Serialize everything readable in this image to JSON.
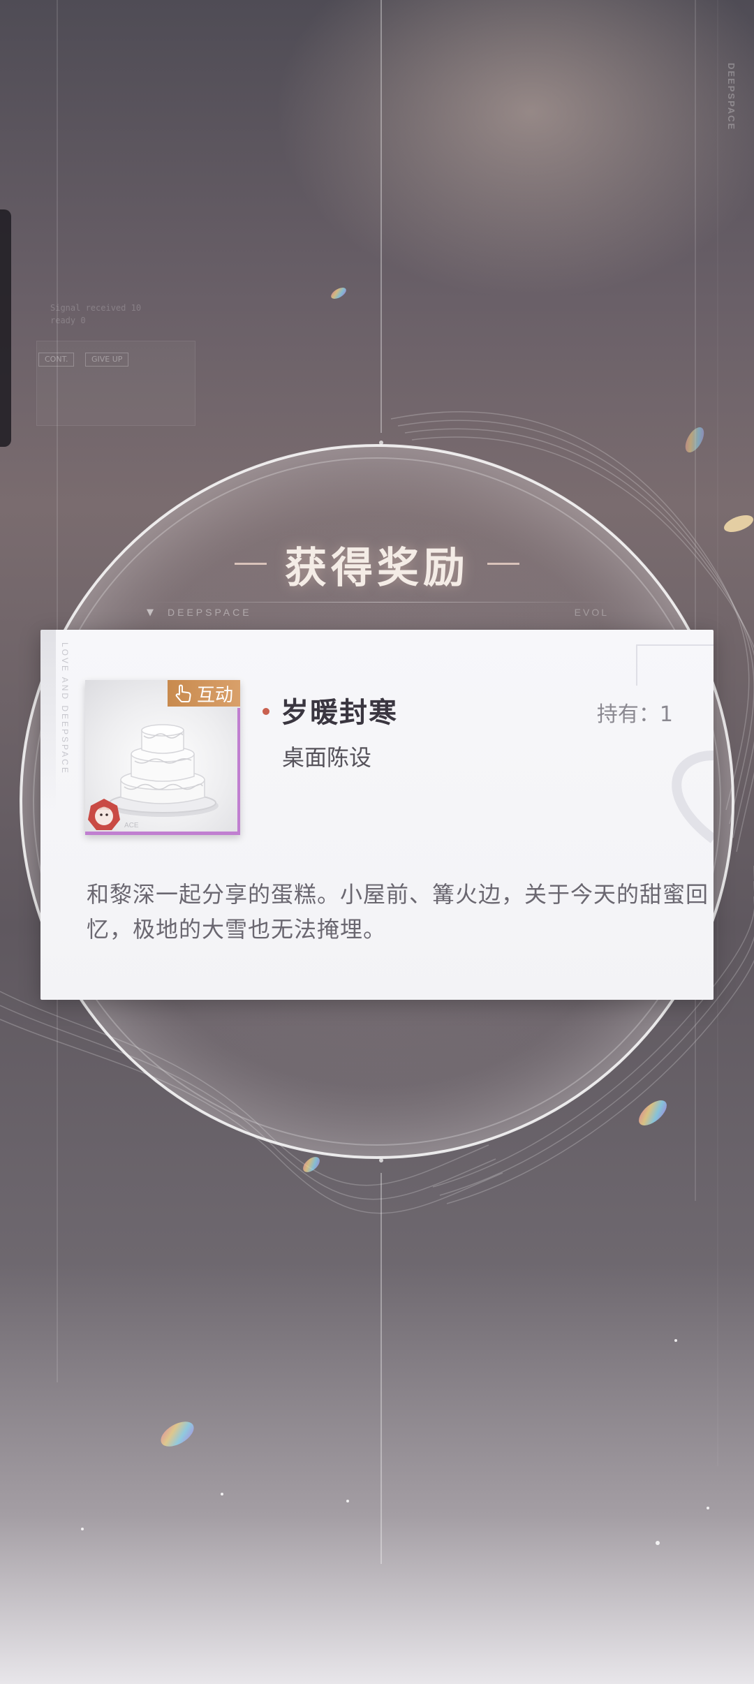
{
  "background": {
    "brand_vertical": "DEEPSPACE",
    "ghost_buttons": [
      "CONT.",
      "GIVE UP"
    ],
    "ghost_lines": [
      "Signal received 10",
      "ready 0"
    ]
  },
  "reward": {
    "title": "获得奖励",
    "subtitle_left": "DEEPSPACE",
    "subtitle_right": "EVOL",
    "card_vertical_text": "LOVE AND DEEPSPACE"
  },
  "item": {
    "name": "岁暖封寒",
    "type": "桌面陈设",
    "owned": "持有：1",
    "tag": "互动",
    "icon": "cake-icon",
    "description": "和黎深一起分享的蛋糕。小屋前、篝火边，关于今天的甜蜜回忆，极地的大雪也无法掩埋。"
  },
  "colors": {
    "accent_tag": "#c88a4e",
    "accent_frame": "#c07fd0",
    "bullet": "#c9604f"
  }
}
